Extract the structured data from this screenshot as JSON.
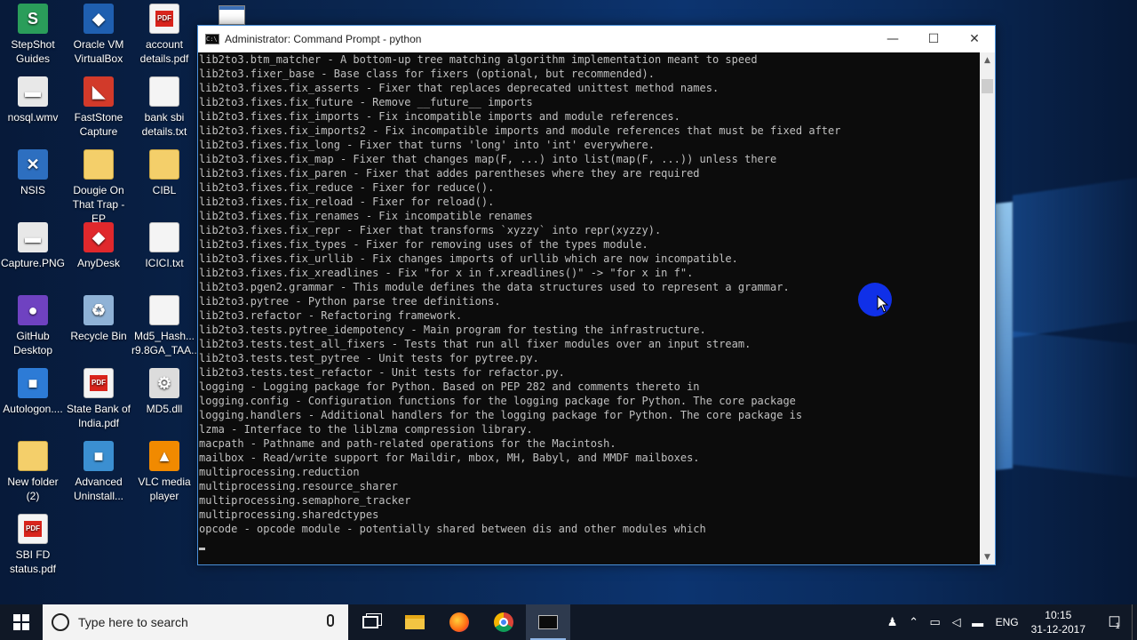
{
  "desktop": {
    "icons": [
      {
        "label": "StepShot Guides",
        "glyph": "S",
        "color": "#2a9d5a"
      },
      {
        "label": "Oracle VM VirtualBox",
        "glyph": "◆",
        "color": "#1f5fb0"
      },
      {
        "label": "account details.pdf",
        "type": "pdf"
      },
      {
        "label": "nosql.wmv",
        "glyph": "▬",
        "color": "#e8e8e8"
      },
      {
        "label": "FastStone Capture",
        "glyph": "◣",
        "color": "#d23a2a"
      },
      {
        "label": "bank sbi details.txt",
        "type": "doc"
      },
      {
        "label": "NSIS",
        "glyph": "✕",
        "color": "#2d6fc0"
      },
      {
        "label": "Dougie On That Trap - EP",
        "type": "folder"
      },
      {
        "label": "CIBL",
        "type": "folder"
      },
      {
        "label": "Capture.PNG",
        "glyph": "▬",
        "color": "#e8e8e8"
      },
      {
        "label": "AnyDesk",
        "glyph": "◆",
        "color": "#e0282c"
      },
      {
        "label": "ICICI.txt",
        "type": "doc"
      },
      {
        "label": "GitHub Desktop",
        "glyph": "●",
        "color": "#6f42c1"
      },
      {
        "label": "Recycle Bin",
        "glyph": "♻",
        "color": "#8fb2d6"
      },
      {
        "label": "Md5_Hash... r9.8GA_TAA...",
        "type": "doc"
      },
      {
        "label": "Autologon....",
        "glyph": "■",
        "color": "#2d7bd6"
      },
      {
        "label": "State Bank of India.pdf",
        "type": "pdf"
      },
      {
        "label": "MD5.dll",
        "glyph": "⚙",
        "color": "#dcdcdc"
      },
      {
        "label": "New folder (2)",
        "type": "folder"
      },
      {
        "label": "Advanced Uninstall...",
        "glyph": "■",
        "color": "#3b8fd1"
      },
      {
        "label": "VLC media player",
        "glyph": "▲",
        "color": "#f18a00"
      },
      {
        "label": "SBI FD status.pdf",
        "type": "pdf"
      }
    ],
    "pdf_badge": "PDF"
  },
  "cmd": {
    "title": "Administrator: Command Prompt - python",
    "icon_text": "C:\\",
    "controls": {
      "minimize": "—",
      "maximize": "☐",
      "close": "✕"
    },
    "lines": [
      "lib2to3.btm_matcher - A bottom-up tree matching algorithm implementation meant to speed",
      "lib2to3.fixer_base - Base class for fixers (optional, but recommended).",
      "lib2to3.fixes.fix_asserts - Fixer that replaces deprecated unittest method names.",
      "lib2to3.fixes.fix_future - Remove __future__ imports",
      "lib2to3.fixes.fix_imports - Fix incompatible imports and module references.",
      "lib2to3.fixes.fix_imports2 - Fix incompatible imports and module references that must be fixed after",
      "lib2to3.fixes.fix_long - Fixer that turns 'long' into 'int' everywhere.",
      "lib2to3.fixes.fix_map - Fixer that changes map(F, ...) into list(map(F, ...)) unless there",
      "lib2to3.fixes.fix_paren - Fixer that addes parentheses where they are required",
      "lib2to3.fixes.fix_reduce - Fixer for reduce().",
      "lib2to3.fixes.fix_reload - Fixer for reload().",
      "lib2to3.fixes.fix_renames - Fix incompatible renames",
      "lib2to3.fixes.fix_repr - Fixer that transforms `xyzzy` into repr(xyzzy).",
      "lib2to3.fixes.fix_types - Fixer for removing uses of the types module.",
      "lib2to3.fixes.fix_urllib - Fix changes imports of urllib which are now incompatible.",
      "lib2to3.fixes.fix_xreadlines - Fix \"for x in f.xreadlines()\" -> \"for x in f\".",
      "lib2to3.pgen2.grammar - This module defines the data structures used to represent a grammar.",
      "lib2to3.pytree - Python parse tree definitions.",
      "lib2to3.refactor - Refactoring framework.",
      "lib2to3.tests.pytree_idempotency - Main program for testing the infrastructure.",
      "lib2to3.tests.test_all_fixers - Tests that run all fixer modules over an input stream.",
      "lib2to3.tests.test_pytree - Unit tests for pytree.py.",
      "lib2to3.tests.test_refactor - Unit tests for refactor.py.",
      "logging - Logging package for Python. Based on PEP 282 and comments thereto in",
      "logging.config - Configuration functions for the logging package for Python. The core package",
      "logging.handlers - Additional handlers for the logging package for Python. The core package is",
      "lzma - Interface to the liblzma compression library.",
      "macpath - Pathname and path-related operations for the Macintosh.",
      "mailbox - Read/write support for Maildir, mbox, MH, Babyl, and MMDF mailboxes.",
      "multiprocessing.reduction",
      "multiprocessing.resource_sharer",
      "multiprocessing.semaphore_tracker",
      "multiprocessing.sharedctypes",
      "opcode - opcode module - potentially shared between dis and other modules which"
    ]
  },
  "taskbar": {
    "search_placeholder": "Type here to search",
    "tray": {
      "language": "ENG",
      "time": "10:15",
      "date": "31-12-2017",
      "notification_count": "1"
    }
  }
}
